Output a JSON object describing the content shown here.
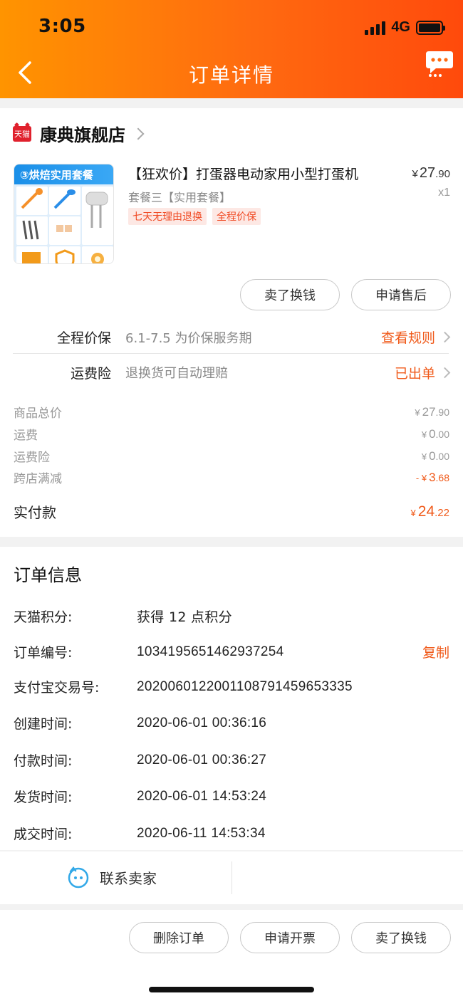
{
  "status_bar": {
    "time": "3:05",
    "network": "4G"
  },
  "header": {
    "title": "订单详情"
  },
  "shop": {
    "badge": "天猫",
    "name": "康典旗舰店"
  },
  "product": {
    "thumb_heading": "③烘焙实用套餐",
    "title": "【狂欢价】打蛋器电动家用小型打蛋机",
    "spec": "套餐三【实用套餐】",
    "tags": [
      "七天无理由退换",
      "全程价保"
    ],
    "price_yen": "¥",
    "price_int": "27",
    "price_dec": ".90",
    "qty": "x1"
  },
  "product_actions": {
    "sell_label": "卖了换钱",
    "aftersale_label": "申请售后"
  },
  "services": [
    {
      "label": "全程价保",
      "desc": "6.1-7.5 为价保服务期",
      "link": "查看规则"
    },
    {
      "label": "运费险",
      "desc": "退换货可自动理赔",
      "link": "已出单"
    }
  ],
  "fees": [
    {
      "label": "商品总价",
      "prefix": "¥",
      "int": "27",
      "dec": ".90"
    },
    {
      "label": "运费",
      "prefix": "¥",
      "int": "0",
      "dec": ".00"
    },
    {
      "label": "运费险",
      "prefix": "¥",
      "int": "0",
      "dec": ".00"
    },
    {
      "label": "跨店满减",
      "prefix": "- ¥",
      "int": "3",
      "dec": ".68"
    }
  ],
  "total": {
    "label": "实付款",
    "prefix": "¥",
    "int": "24",
    "dec": ".22"
  },
  "order_info": {
    "title": "订单信息",
    "rows": [
      {
        "label": "天猫积分:",
        "value": "获得 12 点积分"
      },
      {
        "label": "订单编号:",
        "value": "1034195651462937254",
        "action": "复制"
      },
      {
        "label": "支付宝交易号:",
        "value": "2020060122001108791459653335"
      },
      {
        "label": "创建时间:",
        "value": "2020-06-01 00:36:16"
      },
      {
        "label": "付款时间:",
        "value": "2020-06-01 00:36:27"
      },
      {
        "label": "发货时间:",
        "value": "2020-06-01 14:53:24"
      },
      {
        "label": "成交时间:",
        "value": "2020-06-11 14:53:34"
      }
    ]
  },
  "contact": {
    "label": "联系卖家"
  },
  "bottom_actions": {
    "delete_label": "删除订单",
    "invoice_label": "申请开票",
    "sell_label": "卖了换钱"
  },
  "colors": {
    "brand_orange": "#ff6a10",
    "accent_text": "#f05a1a",
    "tmall_red": "#e0212d"
  }
}
